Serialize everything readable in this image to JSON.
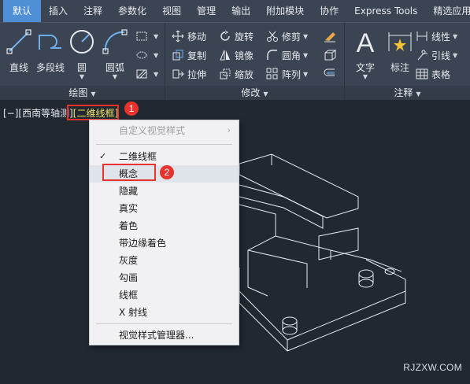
{
  "tabs": [
    "默认",
    "插入",
    "注释",
    "参数化",
    "视图",
    "管理",
    "输出",
    "附加模块",
    "协作",
    "Express Tools",
    "精选应用"
  ],
  "draw_panel": {
    "title": "绘图",
    "line": "直线",
    "polyline": "多段线",
    "circle": "圆",
    "arc": "圆弧"
  },
  "modify_panel": {
    "title": "修改",
    "move": "移动",
    "rotate": "旋转",
    "trim": "修剪",
    "copy": "复制",
    "mirror": "镜像",
    "fillet": "圆角",
    "stretch": "拉伸",
    "scale": "缩放",
    "array": "阵列"
  },
  "annotation_panel": {
    "title": "注释",
    "text": "文字",
    "dimension": "标注",
    "linear": "线性",
    "leader": "引线",
    "table": "表格"
  },
  "viewport": {
    "prefix": "[−][西南等轴测]",
    "visual_style": "[二维线框]"
  },
  "badges": {
    "first": "1",
    "second": "2"
  },
  "menu": {
    "header": "自定义视觉样式",
    "items": [
      "二维线框",
      "概念",
      "隐藏",
      "真实",
      "着色",
      "带边缘着色",
      "灰度",
      "勾画",
      "线框",
      "X 射线"
    ],
    "checked_item": "二维线框",
    "manager": "视觉样式管理器..."
  },
  "watermark": "RJZXW.COM",
  "colors": {
    "accent": "#4f8fd6",
    "highlight": "#f2e266",
    "callout": "#e8322e"
  }
}
